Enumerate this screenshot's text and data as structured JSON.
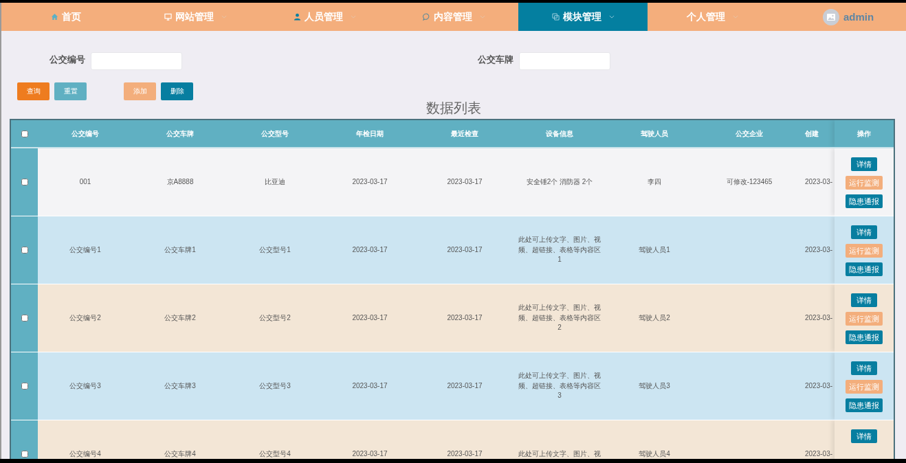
{
  "nav": [
    {
      "label": "首页",
      "selected": false
    },
    {
      "label": "网站管理",
      "selected": false
    },
    {
      "label": "人员管理",
      "selected": false
    },
    {
      "label": "内容管理",
      "selected": false
    },
    {
      "label": "模块管理",
      "selected": true
    },
    {
      "label": "个人管理",
      "selected": false
    }
  ],
  "user": {
    "name": "admin"
  },
  "search": [
    {
      "label": "公交编号"
    },
    {
      "label": "公交车牌"
    }
  ],
  "buttons": [
    {
      "label": "查询",
      "kind": "query"
    },
    {
      "label": "重置",
      "kind": "reset"
    },
    {
      "label": "添加",
      "kind": "add"
    },
    {
      "label": "删除",
      "kind": "delete"
    }
  ],
  "table": {
    "title": "数据列表",
    "select_all": {
      "checked": false
    },
    "columns": [
      "公交编号",
      "公交车牌",
      "公交型号",
      "年检日期",
      "最近检查",
      "设备信息",
      "驾驶人员",
      "公交企业",
      "创建"
    ],
    "actions_header": "操作",
    "rows": [
      {
        "checked": false,
        "hovered": true,
        "cells": [
          "001",
          "京A8888",
          "比亚迪",
          "2023-03-17",
          "2023-03-17",
          "安全锤2个 消防器 2个",
          "李四",
          "可修改-123465",
          "2023-03-"
        ],
        "actions": [
          {
            "label": "详情",
            "kind": "primary"
          },
          {
            "label": "运行监测",
            "kind": "warm"
          },
          {
            "label": "隐患通报",
            "kind": "primary"
          }
        ]
      },
      {
        "checked": false,
        "hovered": false,
        "cells": [
          "公交编号1",
          "公交车牌1",
          "公交型号1",
          "2023-03-17",
          "2023-03-17",
          "此处可上传文字、图片、视频、超链接、表格等内容区1",
          "驾驶人员1",
          "",
          "2023-03-"
        ],
        "actions": [
          {
            "label": "详情",
            "kind": "primary"
          },
          {
            "label": "运行监测",
            "kind": "warm"
          },
          {
            "label": "隐患通报",
            "kind": "primary"
          }
        ]
      },
      {
        "checked": false,
        "hovered": false,
        "cells": [
          "公交编号2",
          "公交车牌2",
          "公交型号2",
          "2023-03-17",
          "2023-03-17",
          "此处可上传文字、图片、视频、超链接、表格等内容区2",
          "驾驶人员2",
          "",
          "2023-03-"
        ],
        "actions": [
          {
            "label": "详情",
            "kind": "primary"
          },
          {
            "label": "运行监测",
            "kind": "warm"
          },
          {
            "label": "隐患通报",
            "kind": "primary"
          }
        ]
      },
      {
        "checked": false,
        "hovered": false,
        "cells": [
          "公交编号3",
          "公交车牌3",
          "公交型号3",
          "2023-03-17",
          "2023-03-17",
          "此处可上传文字、图片、视频、超链接、表格等内容区3",
          "驾驶人员3",
          "",
          "2023-03-"
        ],
        "actions": [
          {
            "label": "详情",
            "kind": "primary"
          },
          {
            "label": "运行监测",
            "kind": "warm"
          },
          {
            "label": "隐患通报",
            "kind": "primary"
          }
        ]
      },
      {
        "checked": false,
        "hovered": false,
        "cells": [
          "公交编号4",
          "公交车牌4",
          "公交型号4",
          "2023-03-17",
          "2023-03-17",
          "此处可上传文字、图片、视",
          "驾驶人员4",
          "",
          "2023-03-"
        ],
        "actions": [
          {
            "label": "详情",
            "kind": "primary"
          }
        ]
      }
    ]
  }
}
